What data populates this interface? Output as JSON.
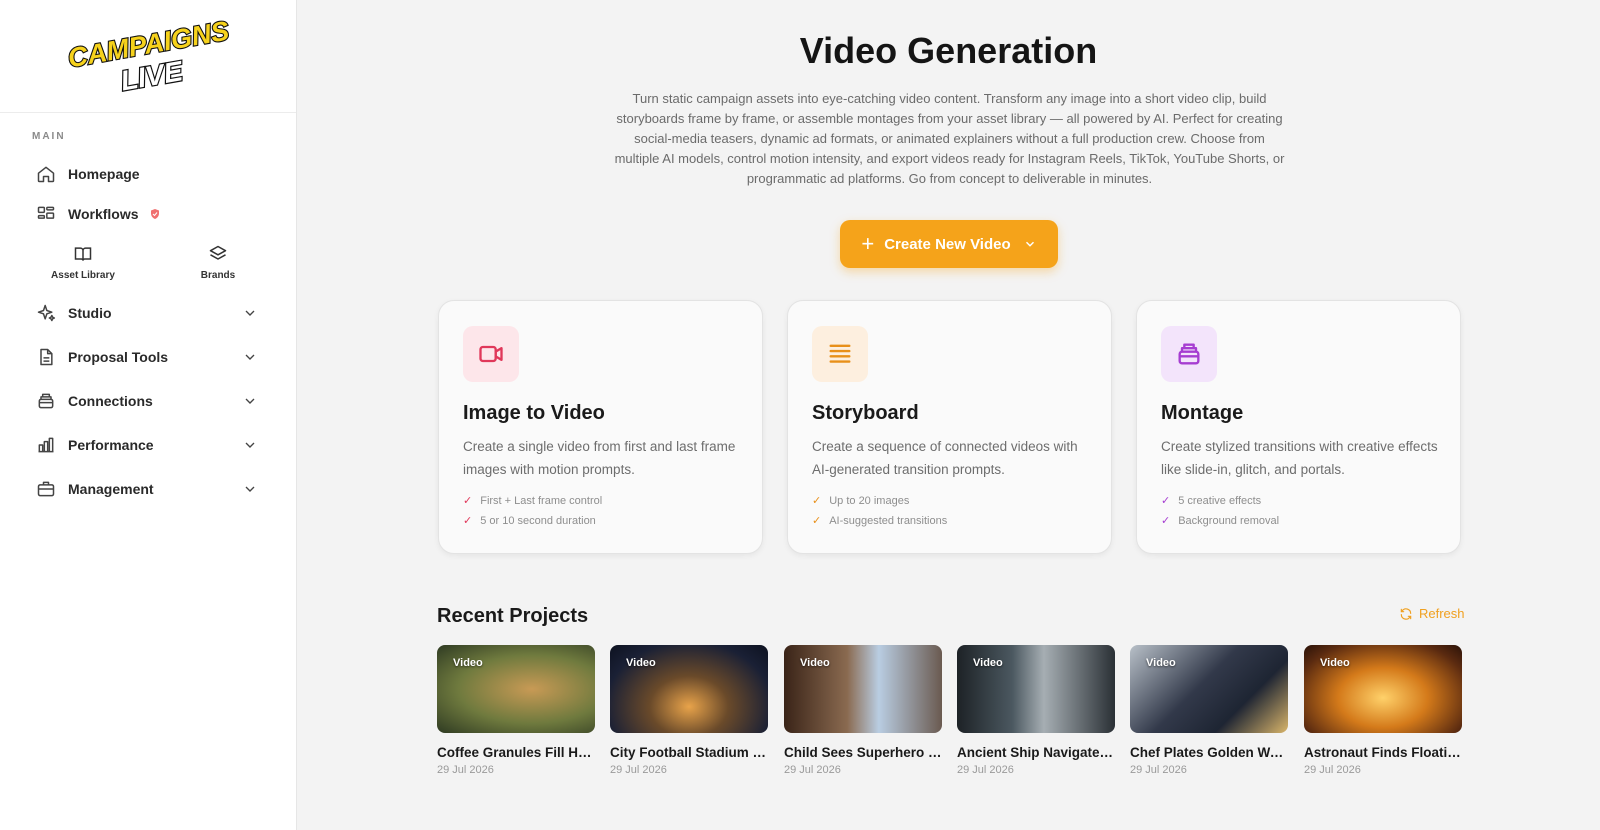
{
  "brand": {
    "logo_text_line1": "CAMPAIGNS",
    "logo_text_line2": "LIVE"
  },
  "sidebar": {
    "section_label": "MAIN",
    "homepage": "Homepage",
    "workflows": "Workflows",
    "asset_library": "Asset Library",
    "brands": "Brands",
    "studio": "Studio",
    "proposal_tools": "Proposal Tools",
    "connections": "Connections",
    "performance": "Performance",
    "management": "Management"
  },
  "page": {
    "title": "Video Generation",
    "description": "Turn static campaign assets into eye-catching video content. Transform any image into a short video clip, build storyboards frame by frame, or assemble montages from your asset library — all powered by AI. Perfect for creating social-media teasers, dynamic ad formats, or animated explainers without a full production crew. Choose from multiple AI models, control motion intensity, and export videos ready for Instagram Reels, TikTok, YouTube Shorts, or programmatic ad platforms. Go from concept to deliverable in minutes.",
    "cta_label": "Create New Video"
  },
  "cards": [
    {
      "title": "Image to Video",
      "description": "Create a single video from first and last frame images with motion prompts.",
      "features": [
        "First + Last frame control",
        "5 or 10 second duration"
      ],
      "accent": "#e0385a",
      "icon_bg": "#fde6ea",
      "icon": "video-camera-icon"
    },
    {
      "title": "Storyboard",
      "description": "Create a sequence of connected videos with AI-generated transition prompts.",
      "features": [
        "Up to 20 images",
        "AI-suggested transitions"
      ],
      "accent": "#e8901a",
      "icon_bg": "#fdefdf",
      "icon": "lines-icon"
    },
    {
      "title": "Montage",
      "description": "Create stylized transitions with creative effects like slide-in, glitch, and portals.",
      "features": [
        "5 creative effects",
        "Background removal"
      ],
      "accent": "#a63dd1",
      "icon_bg": "#f3e4fb",
      "icon": "stack-icon"
    }
  ],
  "recent": {
    "title": "Recent Projects",
    "refresh_label": "Refresh",
    "projects": [
      {
        "tag": "Video",
        "name": "Coffee Granules Fill Ho...",
        "date": "29 Jul 2026"
      },
      {
        "tag": "Video",
        "name": "City Football Stadium R...",
        "date": "29 Jul 2026"
      },
      {
        "tag": "Video",
        "name": "Child Sees Superhero F...",
        "date": "29 Jul 2026"
      },
      {
        "tag": "Video",
        "name": "Ancient Ship Navigates...",
        "date": "29 Jul 2026"
      },
      {
        "tag": "Video",
        "name": "Chef Plates Golden Wa...",
        "date": "29 Jul 2026"
      },
      {
        "tag": "Video",
        "name": "Astronaut Finds Floatin...",
        "date": "29 Jul 2026"
      }
    ]
  },
  "colors": {
    "accent": "#f5a31a",
    "sidebar_bg": "#ffffff",
    "page_bg": "#f3f3f3"
  }
}
